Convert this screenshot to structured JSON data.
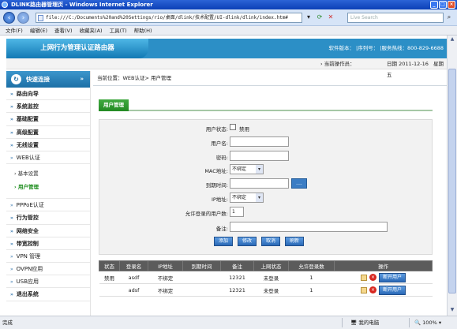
{
  "window": {
    "title": "DLINK路由器管理页 - Windows Internet Explorer"
  },
  "browser": {
    "address": "file:///C:/Documents%20and%20Settings/rio/桌面/dlink/技术配置/UI-dlink/dlink/index.htm#",
    "search_placeholder": "Live Search",
    "menu": [
      "文件(F)",
      "编辑(E)",
      "查看(V)",
      "收藏夹(A)",
      "工具(T)",
      "帮助(H)"
    ],
    "status_done": "完成",
    "status_zone": "我的电脑",
    "status_zoom": "100%"
  },
  "header": {
    "brand": "上网行为管理认证路由器",
    "info": "软件版本：  |序列号：  |服务热线：800-829-6688",
    "operator": "› 当前操作员：",
    "date_label": "日期 2011-12-16",
    "weekday": "星期五"
  },
  "sidebar": {
    "head": "快速连接",
    "items_top": [
      "路由向导",
      "系统监控",
      "基础配置",
      "高级配置",
      "无线设置",
      "WEB认证"
    ],
    "sub_items": [
      "› 基本设置",
      "› 用户管理"
    ],
    "items_bottom": [
      "PPPoE认证",
      "行为管控",
      "网络安全",
      "带宽控制",
      "VPN 管理",
      "OVPN应用",
      "USB应用",
      "退出系统"
    ]
  },
  "main": {
    "breadcrumb": "当前位置：WEB认证> 用户管理",
    "tab": "用户管理",
    "form": {
      "status_label": "用户状态:",
      "status_option": "禁用",
      "username_label": "用户名:",
      "username_value": "",
      "password_label": "密码:",
      "password_value": "",
      "mac_label": "MAC地址:",
      "mac_value": "不绑定",
      "expire_label": "到期时间:",
      "expire_value": "",
      "expire_button": "....",
      "ip_label": "IP地址:",
      "ip_value": "不绑定",
      "maxusers_label": "允许登录的用户数:",
      "maxusers_value": "1",
      "note_label": "备注:",
      "note_value": ""
    },
    "buttons": [
      "添加",
      "修改",
      "取消",
      "刷新"
    ],
    "table": {
      "headers": [
        "状态",
        "登录名",
        "IP地址",
        "到期时间",
        "备注",
        "上网状态",
        "允许登录数",
        "操作"
      ],
      "rows": [
        {
          "status": "禁用",
          "login": "asdf",
          "ip": "不绑定",
          "expire": "",
          "note": "12321",
          "online": "未登录",
          "allowed": "1",
          "action": "断开用户"
        },
        {
          "status": "",
          "login": "adsf",
          "ip": "不绑定",
          "expire": "",
          "note": "12321",
          "online": "未登录",
          "allowed": "1",
          "action": "断开用户"
        }
      ]
    }
  }
}
